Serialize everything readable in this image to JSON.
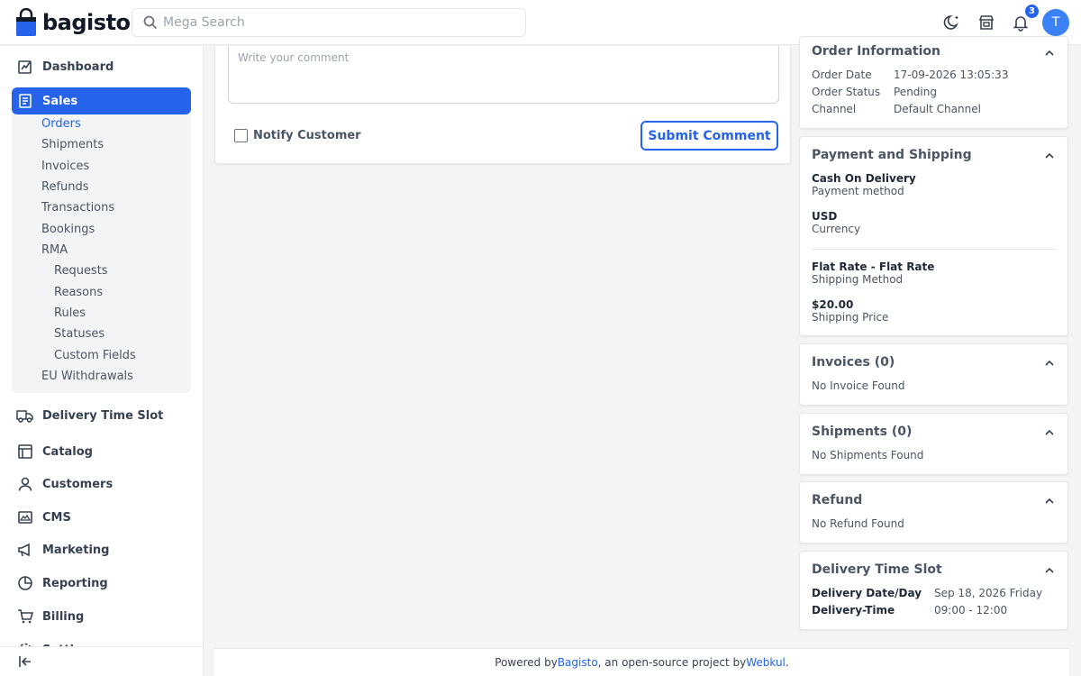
{
  "header": {
    "brand": "bagisto",
    "search_placeholder": "Mega Search",
    "notification_count": "3",
    "avatar_initial": "T",
    "icons": [
      "dark-mode-icon",
      "storefront-icon",
      "bell-icon"
    ]
  },
  "sidebar": {
    "dashboard": "Dashboard",
    "sales": "Sales",
    "sales_items": [
      "Orders",
      "Shipments",
      "Invoices",
      "Refunds",
      "Transactions",
      "Bookings",
      "RMA"
    ],
    "rma_items": [
      "Requests",
      "Reasons",
      "Rules",
      "Statuses",
      "Custom Fields"
    ],
    "eu_withdrawals": "EU Withdrawals",
    "delivery_time_slot": "Delivery Time Slot",
    "catalog": "Catalog",
    "customers": "Customers",
    "cms": "CMS",
    "marketing": "Marketing",
    "reporting": "Reporting",
    "billing": "Billing",
    "settings": "Settings"
  },
  "comment": {
    "placeholder": "Write your comment",
    "notify_label": "Notify Customer",
    "submit_label": "Submit Comment"
  },
  "order_info": {
    "title": "Order Information",
    "date_label": "Order Date",
    "date_value": "17-09-2026 13:05:33",
    "status_label": "Order Status",
    "status_value": "Pending",
    "channel_label": "Channel",
    "channel_value": "Default Channel"
  },
  "payment_shipping": {
    "title": "Payment and Shipping",
    "payment_value": "Cash On Delivery",
    "payment_label": "Payment method",
    "currency_value": "USD",
    "currency_label": "Currency",
    "shipping_value": "Flat Rate - Flat Rate",
    "shipping_label": "Shipping Method",
    "price_value": "$20.00",
    "price_label": "Shipping Price"
  },
  "invoices": {
    "title": "Invoices (0)",
    "empty": "No Invoice Found"
  },
  "shipments": {
    "title": "Shipments (0)",
    "empty": "No Shipments Found"
  },
  "refund": {
    "title": "Refund",
    "empty": "No Refund Found"
  },
  "delivery_slot": {
    "title": "Delivery Time Slot",
    "date_label": "Delivery Date/Day",
    "date_value": "Sep 18, 2026 Friday",
    "time_label": "Delivery-Time",
    "time_value": "09:00 - 12:00"
  },
  "footer": {
    "prefix": "Powered by ",
    "bagisto_link": "Bagisto",
    "middle": ", an open-source project by ",
    "webkul_link": "Webkul",
    "suffix": "."
  }
}
